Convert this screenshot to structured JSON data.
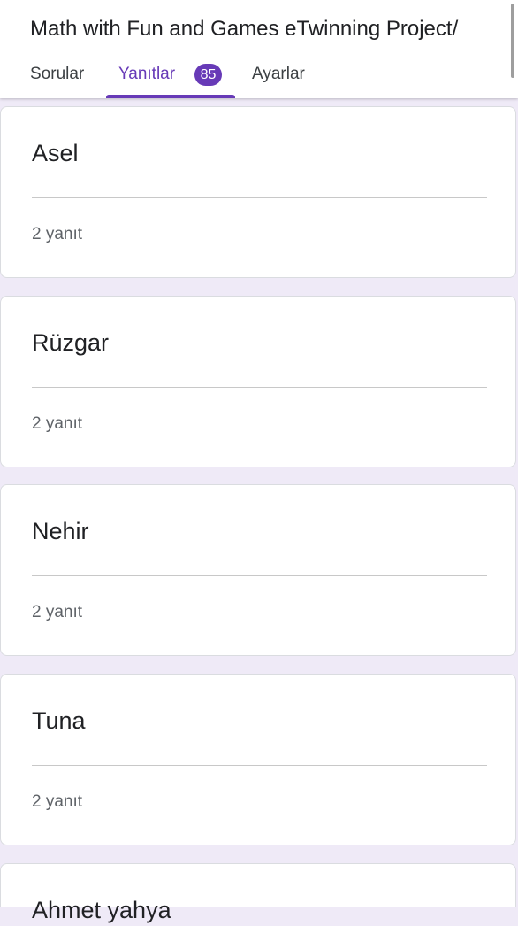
{
  "header": {
    "title": "Math with Fun and Games eTwinning Project/",
    "tabs": {
      "questions": "Sorular",
      "responses": "Yanıtlar",
      "responses_count": "85",
      "settings": "Ayarlar"
    }
  },
  "colors": {
    "accent": "#673ab7",
    "background": "#efeaf7"
  },
  "respondents": [
    {
      "name": "Asel",
      "count": "2 yanıt"
    },
    {
      "name": "Rüzgar",
      "count": "2 yanıt"
    },
    {
      "name": "Nehir",
      "count": "2 yanıt"
    },
    {
      "name": "Tuna",
      "count": "2 yanıt"
    },
    {
      "name": "Ahmet yahya",
      "count": ""
    }
  ]
}
